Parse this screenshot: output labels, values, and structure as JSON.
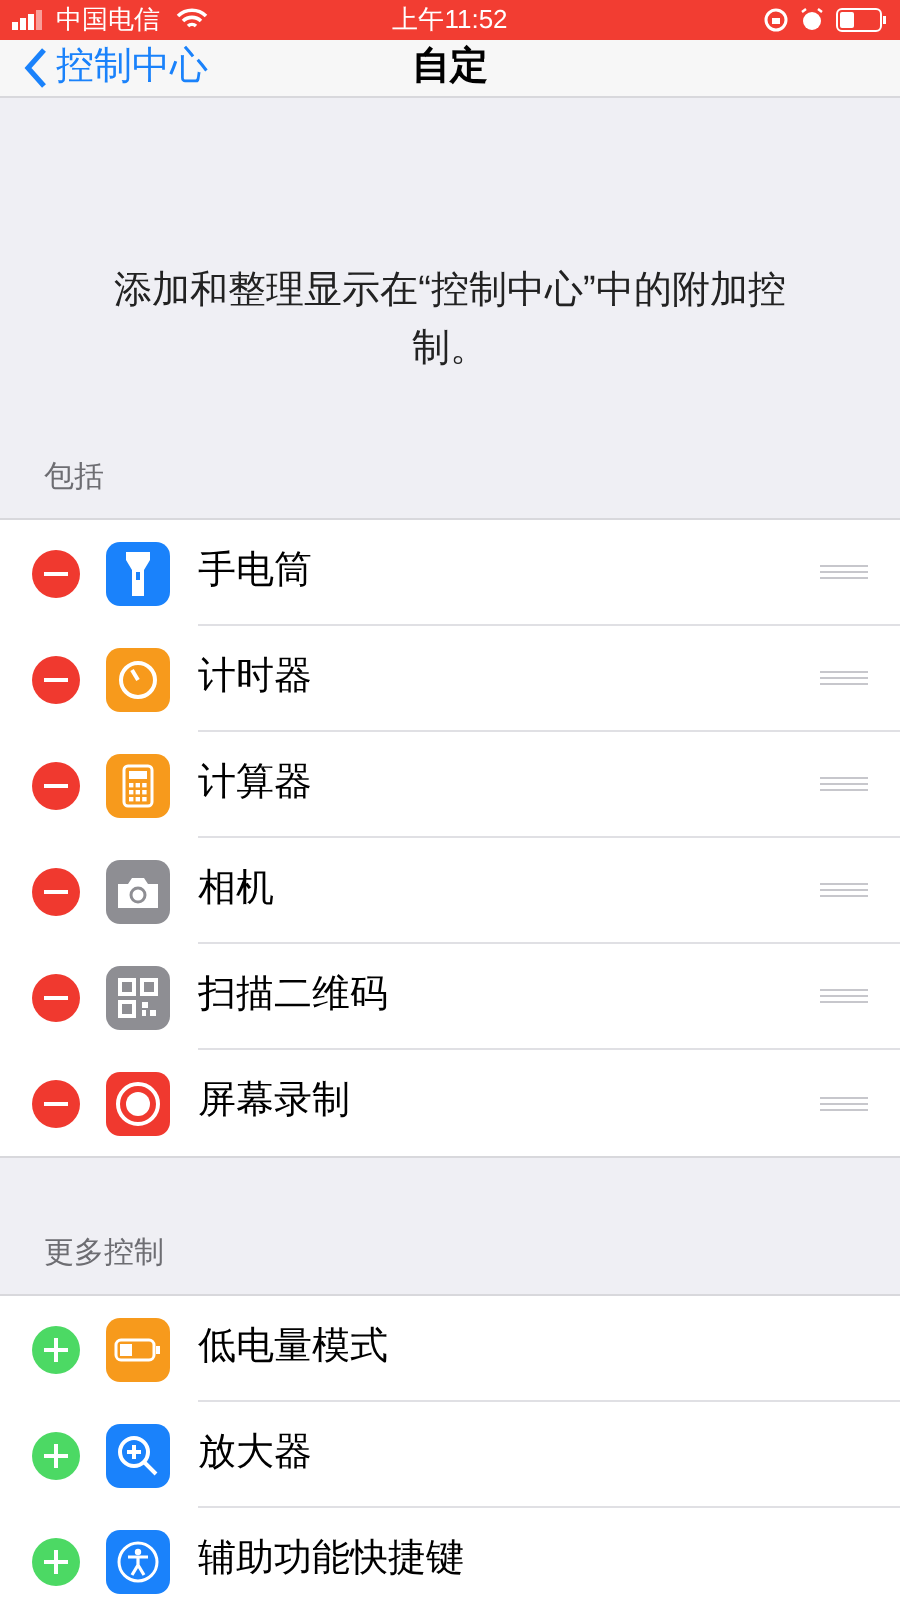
{
  "status_bar": {
    "carrier": "中国电信",
    "time": "上午11:52"
  },
  "nav": {
    "back": "控制中心",
    "title": "自定"
  },
  "description": "添加和整理显示在“控制中心”中的附加控制。",
  "sections": [
    {
      "header": "包括",
      "included": true,
      "items": [
        {
          "label": "手电筒",
          "kind": "flashlight",
          "color": "#1a82fb"
        },
        {
          "label": "计时器",
          "kind": "timer",
          "color": "#f79a1c"
        },
        {
          "label": "计算器",
          "kind": "calculator",
          "color": "#f79a1c"
        },
        {
          "label": "相机",
          "kind": "camera",
          "color": "#8e8e93"
        },
        {
          "label": "扫描二维码",
          "kind": "qrcode",
          "color": "#8e8e93"
        },
        {
          "label": "屏幕录制",
          "kind": "record",
          "color": "#f0392f"
        }
      ]
    },
    {
      "header": "更多控制",
      "included": false,
      "items": [
        {
          "label": "低电量模式",
          "kind": "battery",
          "color": "#f79a1c"
        },
        {
          "label": "放大器",
          "kind": "magnifier",
          "color": "#1a82fb"
        },
        {
          "label": "辅助功能快捷键",
          "kind": "accessibility",
          "color": "#1a82fb"
        }
      ]
    }
  ]
}
